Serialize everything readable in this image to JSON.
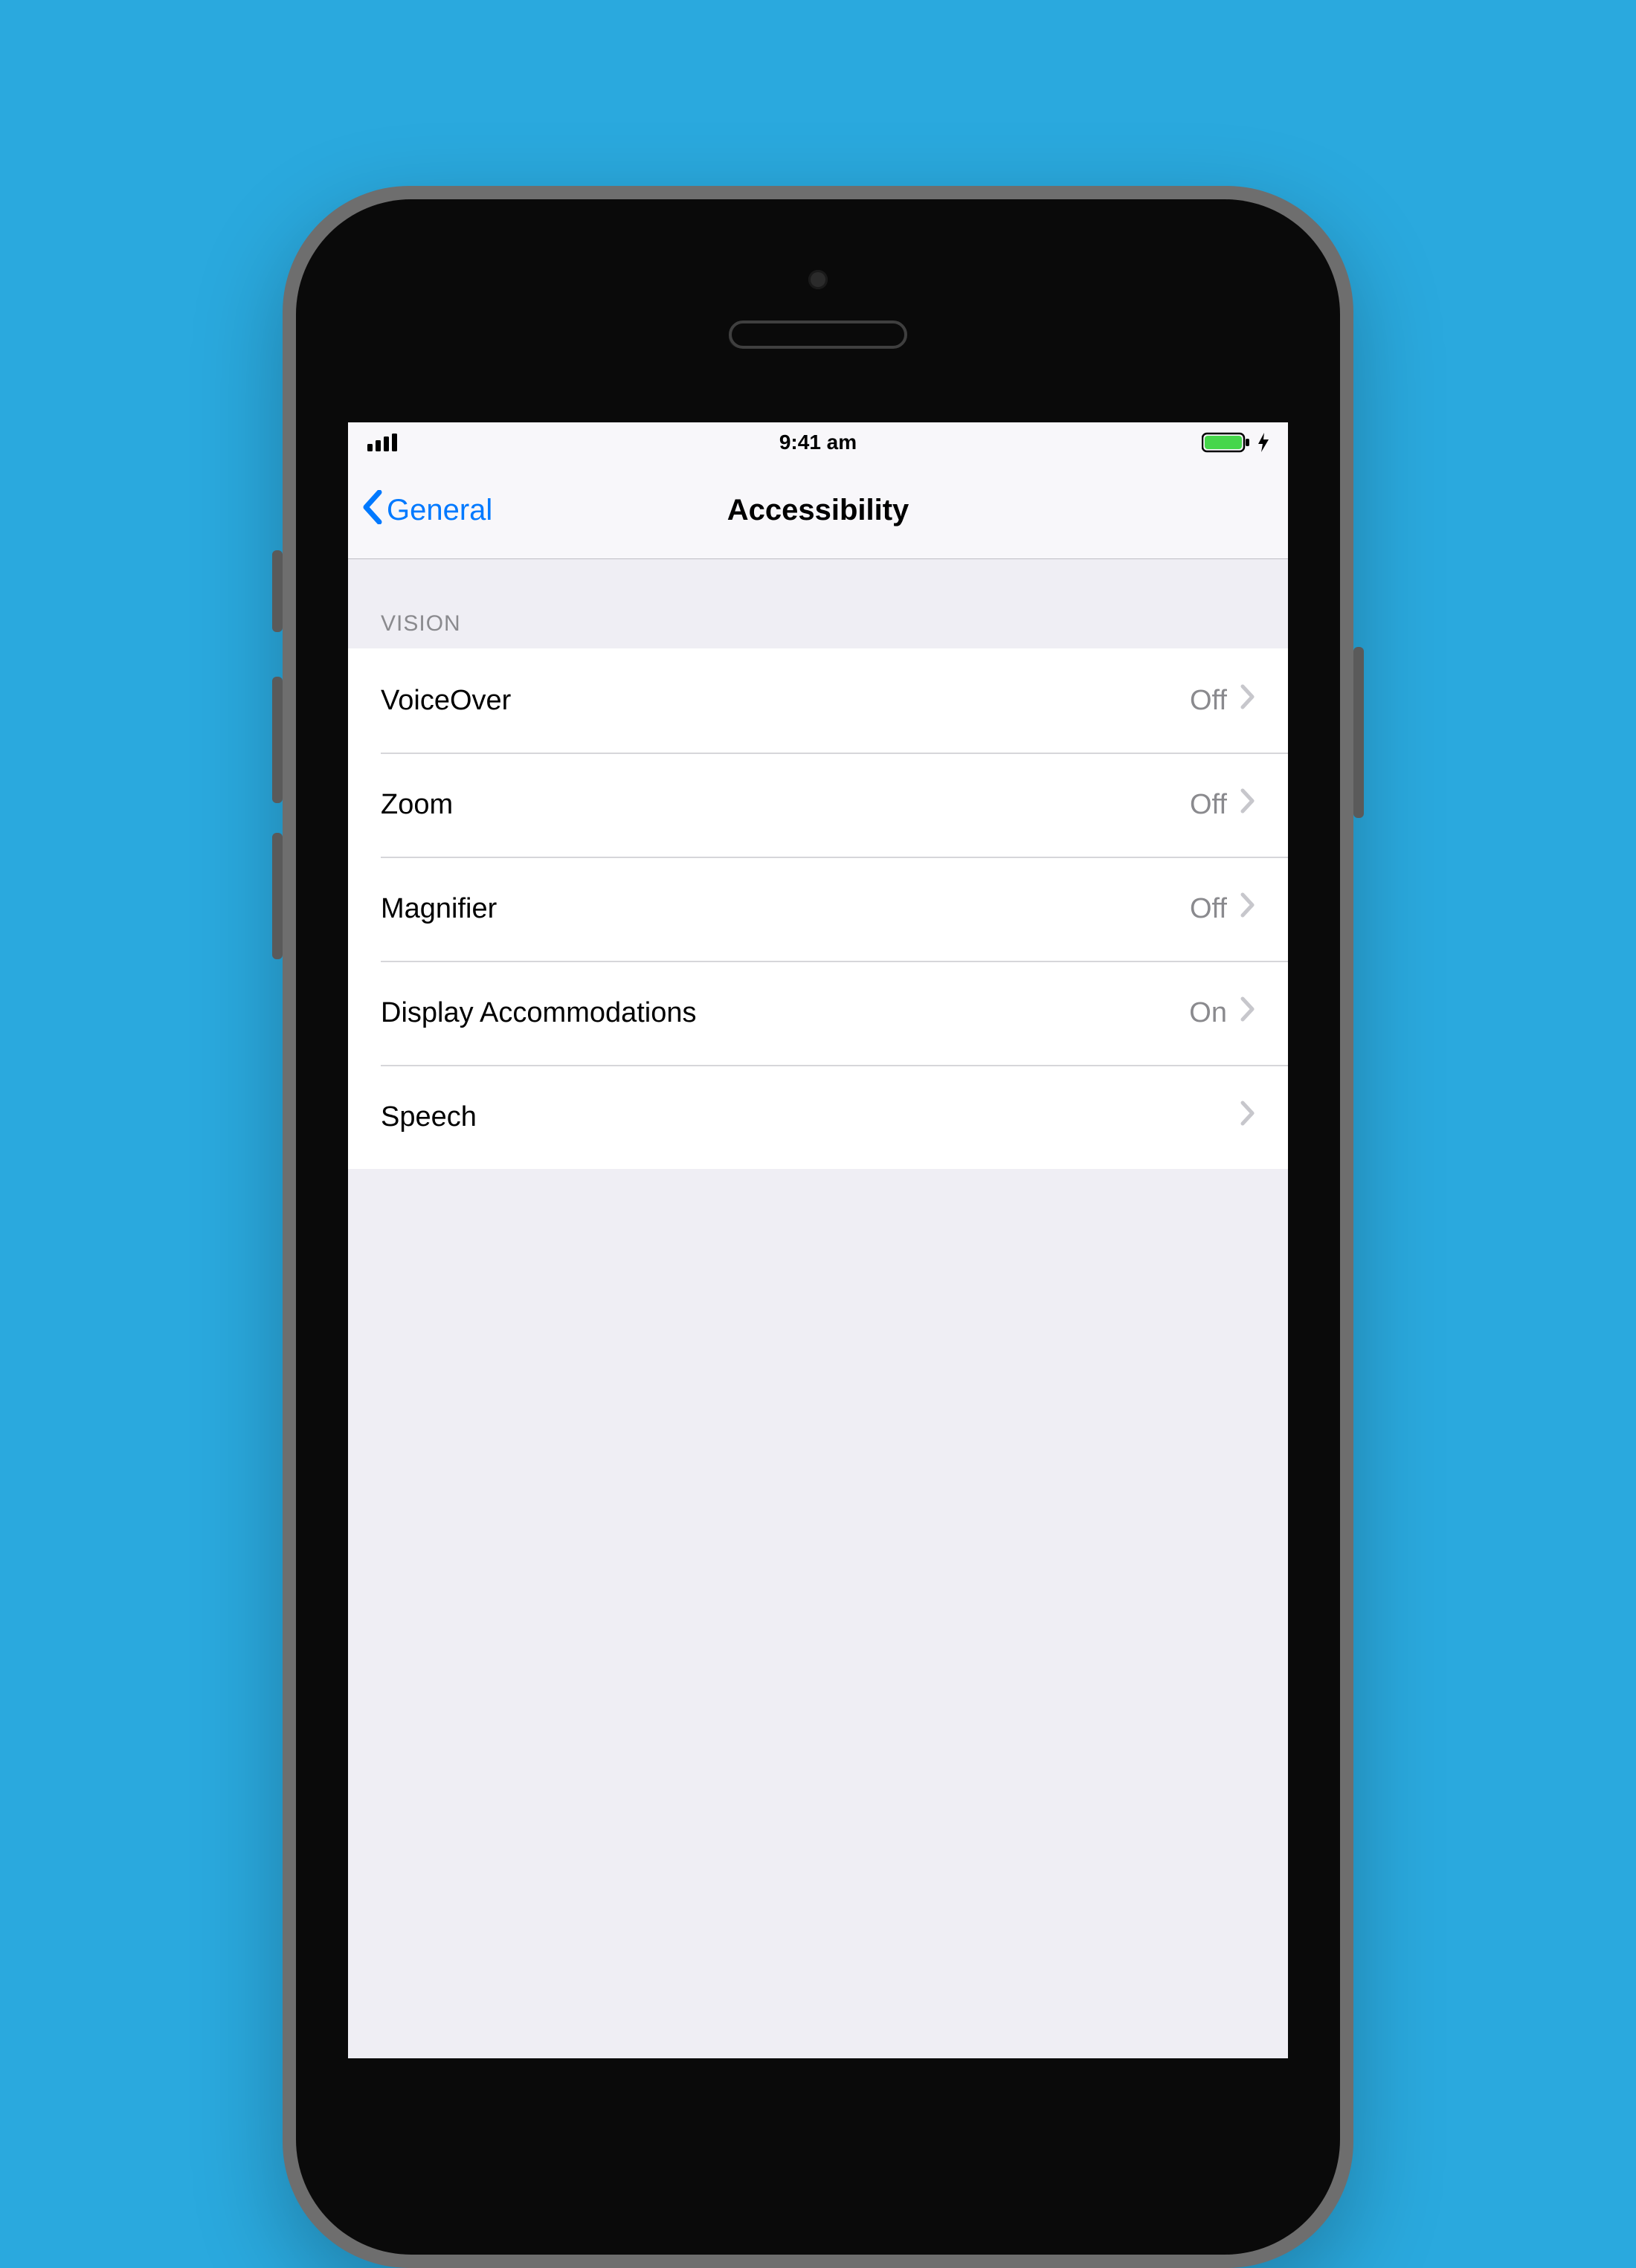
{
  "statusbar": {
    "time": "9:41 am"
  },
  "navbar": {
    "back_label": "General",
    "title": "Accessibility"
  },
  "section": {
    "header": "VISION",
    "rows": [
      {
        "label": "VoiceOver",
        "value": "Off"
      },
      {
        "label": "Zoom",
        "value": "Off"
      },
      {
        "label": "Magnifier",
        "value": "Off"
      },
      {
        "label": "Display Accommodations",
        "value": "On"
      },
      {
        "label": "Speech",
        "value": ""
      }
    ]
  },
  "colors": {
    "background": "#2aa9de",
    "ios_blue": "#0079ff",
    "battery_green": "#46d64b"
  }
}
